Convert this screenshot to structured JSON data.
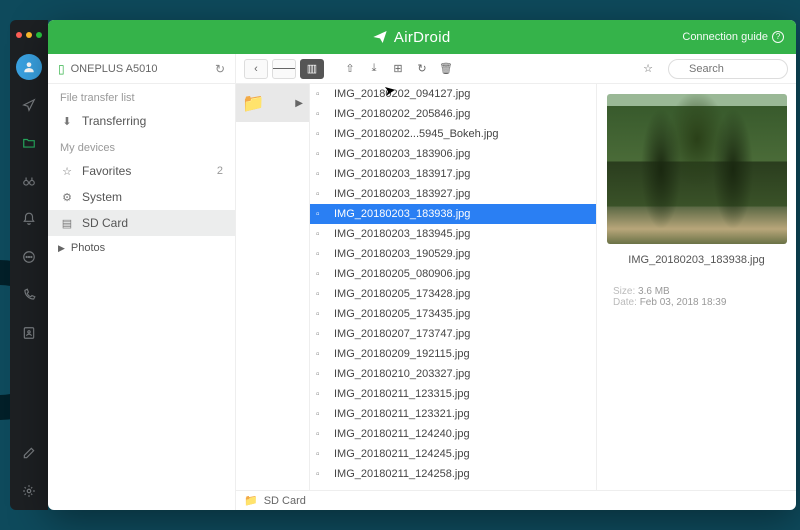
{
  "header": {
    "brand": "AirDroid",
    "connection_guide": "Connection guide"
  },
  "device": {
    "name": "ONEPLUS A5010"
  },
  "sidebar": {
    "file_transfer_label": "File transfer list",
    "transferring": "Transferring",
    "my_devices_label": "My devices",
    "items": [
      {
        "icon": "star",
        "label": "Favorites",
        "badge": "2"
      },
      {
        "icon": "gear",
        "label": "System",
        "badge": ""
      },
      {
        "icon": "sdcard",
        "label": "SD Card",
        "badge": ""
      }
    ],
    "tree": [
      {
        "label": "Photos"
      }
    ]
  },
  "search": {
    "placeholder": "Search"
  },
  "files": [
    "IMG_20180202_094127.jpg",
    "IMG_20180202_205846.jpg",
    "IMG_20180202...5945_Bokeh.jpg",
    "IMG_20180203_183906.jpg",
    "IMG_20180203_183917.jpg",
    "IMG_20180203_183927.jpg",
    "IMG_20180203_183938.jpg",
    "IMG_20180203_183945.jpg",
    "IMG_20180203_190529.jpg",
    "IMG_20180205_080906.jpg",
    "IMG_20180205_173428.jpg",
    "IMG_20180205_173435.jpg",
    "IMG_20180207_173747.jpg",
    "IMG_20180209_192115.jpg",
    "IMG_20180210_203327.jpg",
    "IMG_20180211_123315.jpg",
    "IMG_20180211_123321.jpg",
    "IMG_20180211_124240.jpg",
    "IMG_20180211_124245.jpg",
    "IMG_20180211_124258.jpg"
  ],
  "selected_index": 6,
  "preview": {
    "filename": "IMG_20180203_183938.jpg",
    "size_label": "Size:",
    "size_value": "3.6 MB",
    "date_label": "Date:",
    "date_value": "Feb 03, 2018 18:39"
  },
  "statusbar": {
    "path": "SD Card"
  }
}
